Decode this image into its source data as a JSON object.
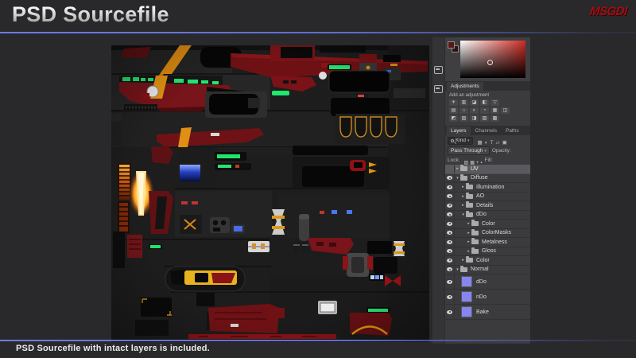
{
  "header": {
    "title": "PSD Sourcefile",
    "logo_text": "MSGDI"
  },
  "footer": {
    "caption": "PSD Sourcefile with intact layers is included."
  },
  "colors": {
    "slide_background": "#29292b",
    "accent_line_blue": "#5e6cd0",
    "logo_red": "#a30d11",
    "panel_background": "#3b3b3d",
    "layer_thumb_purple": "#8587ee",
    "picker_foreground_swatch": "#5a1717",
    "picker_background_swatch": "#301212"
  },
  "photoshop_panel": {
    "color_picker": {
      "hue": "red"
    },
    "adjustments": {
      "tab_label": "Adjustments",
      "hint": "Add an adjustment",
      "icon_rows": [
        [
          "brightness-contrast",
          "levels",
          "curves",
          "exposure",
          "vibrance"
        ],
        [
          "hue-saturation",
          "color-balance",
          "black-white",
          "photo-filter",
          "channel-mixer",
          "color-lookup"
        ],
        [
          "invert",
          "posterize",
          "threshold",
          "selective-color",
          "gradient-map"
        ]
      ]
    },
    "layers_panel": {
      "tabs": [
        {
          "label": "Layers",
          "active": true
        },
        {
          "label": "Channels",
          "active": false
        },
        {
          "label": "Paths",
          "active": false
        }
      ],
      "filter_label": "Kind",
      "filter_icons": [
        "pixel-filter",
        "adjustment-filter",
        "type-filter",
        "shape-filter",
        "smart-object-filter"
      ],
      "blend_mode": "Pass Through",
      "opacity_label": "Opacity:",
      "lock_label": "Lock:",
      "lock_icons": [
        "lock-transparency",
        "lock-pixels",
        "lock-position",
        "lock-all"
      ],
      "fill_label": "Fill:",
      "layers": [
        {
          "name": "UV",
          "type": "group",
          "depth": 0,
          "expanded": false,
          "visible": false,
          "selected": true
        },
        {
          "name": "Diffuse",
          "type": "group",
          "depth": 0,
          "expanded": true,
          "visible": true,
          "selected": false
        },
        {
          "name": "Illumination",
          "type": "group",
          "depth": 1,
          "expanded": false,
          "visible": true,
          "selected": false
        },
        {
          "name": "AO",
          "type": "group",
          "depth": 1,
          "expanded": false,
          "visible": true,
          "selected": false
        },
        {
          "name": "Details",
          "type": "group",
          "depth": 1,
          "expanded": false,
          "visible": true,
          "selected": false
        },
        {
          "name": "dDo",
          "type": "group",
          "depth": 1,
          "expanded": true,
          "visible": true,
          "selected": false
        },
        {
          "name": "Color",
          "type": "group",
          "depth": 2,
          "expanded": false,
          "visible": true,
          "selected": false
        },
        {
          "name": "ColorMasks",
          "type": "group",
          "depth": 2,
          "expanded": false,
          "visible": true,
          "selected": false
        },
        {
          "name": "Metalness",
          "type": "group",
          "depth": 2,
          "expanded": false,
          "visible": true,
          "selected": false
        },
        {
          "name": "Gloss",
          "type": "group",
          "depth": 2,
          "expanded": false,
          "visible": true,
          "selected": false
        },
        {
          "name": "Color",
          "type": "group",
          "depth": 1,
          "expanded": false,
          "visible": true,
          "selected": false
        },
        {
          "name": "Normal",
          "type": "group",
          "depth": 0,
          "expanded": true,
          "visible": true,
          "selected": false
        },
        {
          "name": "dDo",
          "type": "layer",
          "depth": 1,
          "visible": true,
          "selected": false,
          "thumb": "#8587ee"
        },
        {
          "name": "nDo",
          "type": "layer",
          "depth": 1,
          "visible": true,
          "selected": false,
          "thumb": "#8587ee"
        },
        {
          "name": "Bake",
          "type": "layer",
          "depth": 1,
          "visible": true,
          "selected": false,
          "thumb": "#8587ee"
        }
      ]
    }
  }
}
